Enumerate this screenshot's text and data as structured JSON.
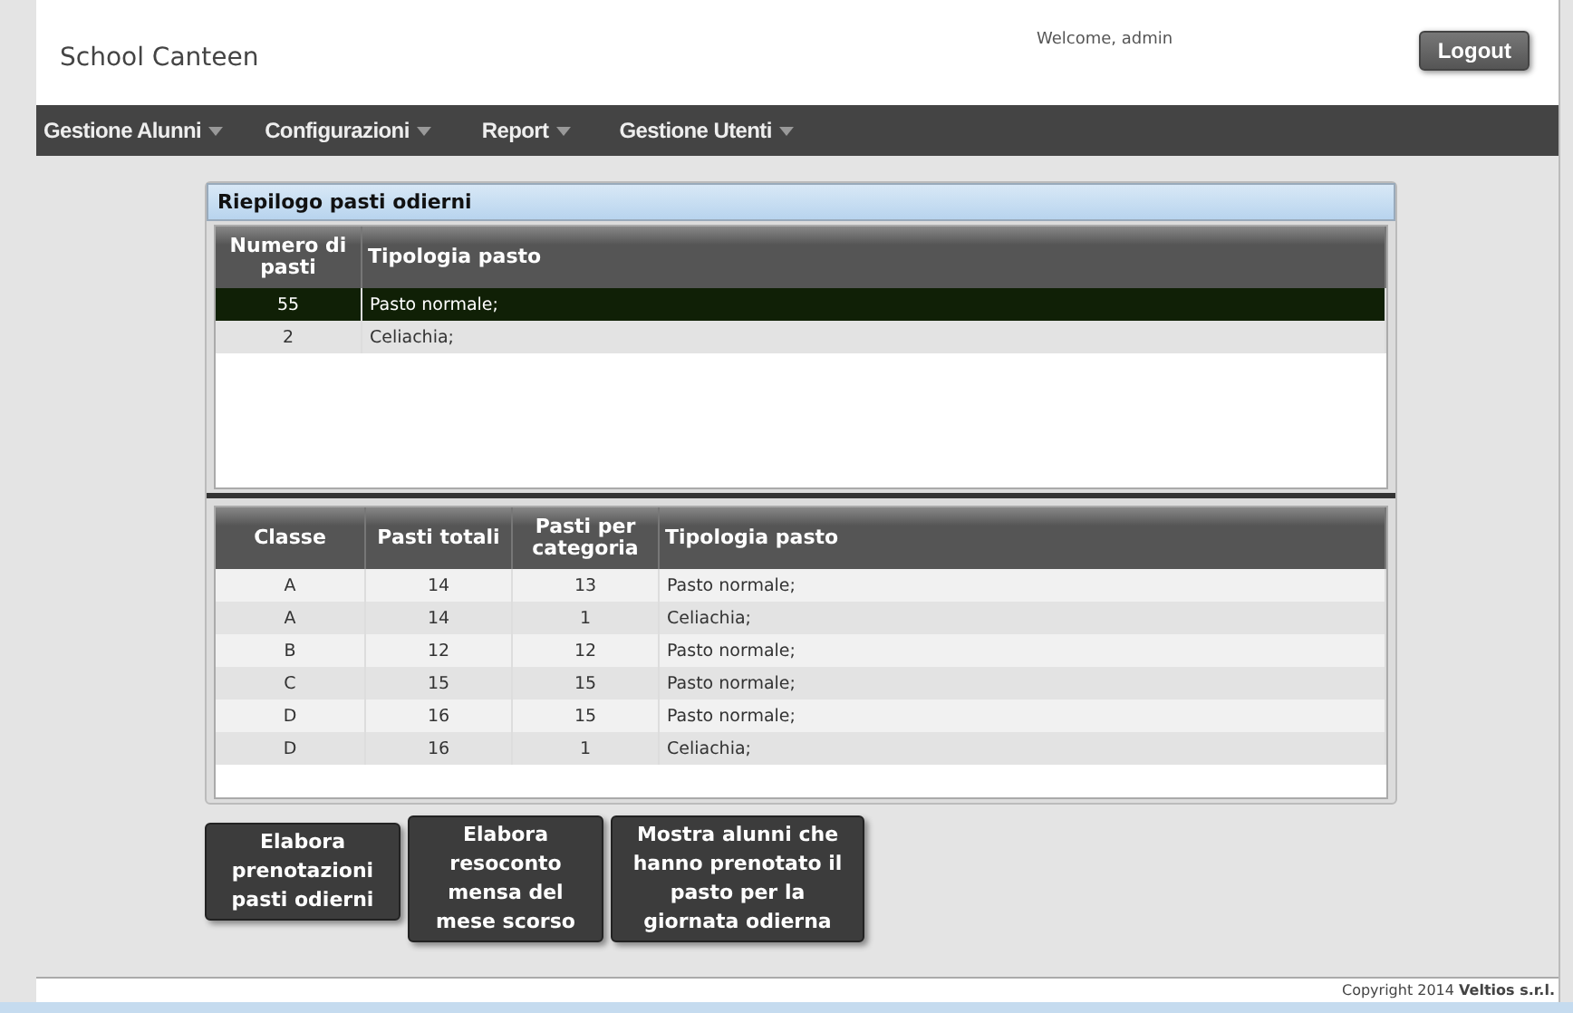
{
  "header": {
    "title": "School Canteen",
    "welcome": "Welcome, admin",
    "logout": "Logout"
  },
  "menu": [
    {
      "label": "Gestione Alunni"
    },
    {
      "label": "Configurazioni"
    },
    {
      "label": "Report"
    },
    {
      "label": "Gestione Utenti"
    }
  ],
  "panel": {
    "title": "Riepilogo pasti odierni",
    "summary_table": {
      "columns": [
        "Numero di pasti",
        "Tipologia pasto"
      ],
      "rows": [
        {
          "cells": [
            "55",
            "Pasto normale;"
          ],
          "selected": true
        },
        {
          "cells": [
            "2",
            "Celiachia;"
          ],
          "selected": false
        }
      ]
    },
    "class_table": {
      "columns": [
        "Classe",
        "Pasti totali",
        "Pasti per categoria",
        "Tipologia pasto"
      ],
      "rows": [
        {
          "cells": [
            "A",
            "14",
            "13",
            "Pasto normale;"
          ]
        },
        {
          "cells": [
            "A",
            "14",
            "1",
            "Celiachia;"
          ]
        },
        {
          "cells": [
            "B",
            "12",
            "12",
            "Pasto normale;"
          ]
        },
        {
          "cells": [
            "C",
            "15",
            "15",
            "Pasto normale;"
          ]
        },
        {
          "cells": [
            "D",
            "16",
            "15",
            "Pasto normale;"
          ]
        },
        {
          "cells": [
            "D",
            "16",
            "1",
            "Celiachia;"
          ]
        }
      ]
    }
  },
  "buttons": [
    "Elabora prenotazioni pasti odierni",
    "Elabora resoconto mensa del mese scorso",
    "Mostra alunni che hanno prenotato il pasto per la giornata odierna"
  ],
  "footer": "Copyright 2014 **Veltios s.r.l.**"
}
